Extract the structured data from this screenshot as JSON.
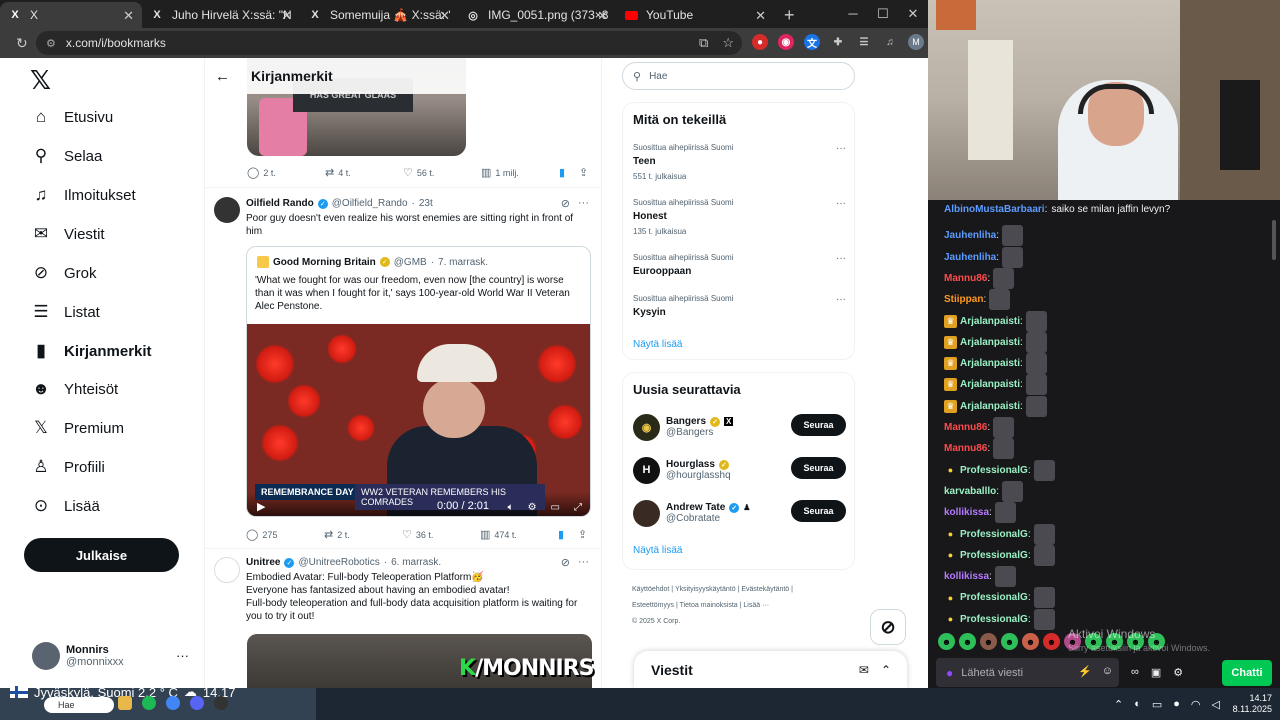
{
  "browser": {
    "tabs": [
      {
        "label": "X",
        "icon": "x-logo-icon",
        "active": true
      },
      {
        "label": "Juho Hirvelä X:ssä: \"Neljäs tans",
        "icon": "x-logo-icon"
      },
      {
        "label": "Somemuija 🎪 X:ssä: \"Hei isä! I",
        "icon": "x-logo-icon"
      },
      {
        "label": "IMG_0051.png (373×807)",
        "icon": "globe-icon"
      },
      {
        "label": "YouTube",
        "icon": "youtube-icon"
      }
    ],
    "url": "x.com/i/bookmarks"
  },
  "nav": {
    "items": [
      {
        "label": "Etusivu",
        "icon": "home-icon"
      },
      {
        "label": "Selaa",
        "icon": "search-icon"
      },
      {
        "label": "Ilmoitukset",
        "icon": "bell-icon"
      },
      {
        "label": "Viestit",
        "icon": "envelope-icon"
      },
      {
        "label": "Grok",
        "icon": "grok-icon"
      },
      {
        "label": "Listat",
        "icon": "list-icon"
      },
      {
        "label": "Kirjanmerkit",
        "icon": "bookmark-icon"
      },
      {
        "label": "Yhteisöt",
        "icon": "people-icon"
      },
      {
        "label": "Premium",
        "icon": "x-logo-icon"
      },
      {
        "label": "Profiili",
        "icon": "person-icon"
      },
      {
        "label": "Lisää",
        "icon": "more-circle-icon"
      }
    ],
    "post_button": "Julkaise",
    "account": {
      "name": "Monnirs",
      "handle": "@monnixxx"
    }
  },
  "timeline": {
    "title": "Kirjanmerkit",
    "top_image_text": "HAS GREAT GLAAS",
    "top_actions": {
      "replies": "2 t.",
      "reposts": "4 t.",
      "likes": "56 t.",
      "views": "1 milj."
    },
    "tweet1": {
      "name": "Oilfield Rando",
      "handle": "@Oilfield_Rando",
      "time": "23t",
      "text": "Poor guy doesn't even realize his worst enemies are sitting right in front of him",
      "quote": {
        "name": "Good Morning Britain",
        "handle": "@GMB",
        "time": "7. marrask.",
        "text": "'What we fought for was our freedom, even now [the country] is worse than it was when I fought for it,' says 100-year-old World War II Veteran Alec Penstone.",
        "banner_left": "REMEMBRANCE DAY",
        "banner_right": "WW2 VETERAN REMEMBERS HIS COMRADES",
        "video_time": "0:00 / 2:01"
      },
      "actions": {
        "replies": "275",
        "reposts": "2 t.",
        "likes": "36 t.",
        "views": "474 t."
      }
    },
    "tweet2": {
      "name": "Unitree",
      "handle": "@UnitreeRobotics",
      "time": "6. marrask.",
      "line1": "Embodied Avatar: Full-body Teleoperation Platform🥳",
      "line2": "Everyone has fantasized about having an embodied avatar!",
      "line3": "Full-body teleoperation and full-body data acquisition platform is waiting for you to try it out!"
    }
  },
  "sidebar": {
    "search_placeholder": "Hae",
    "trending_title": "Mitä on tekeillä",
    "trends": [
      {
        "context": "Suosittua aihepiirissä Suomi",
        "name": "Teen",
        "count": "551 t. julkaisua"
      },
      {
        "context": "Suosittua aihepiirissä Suomi",
        "name": "Honest",
        "count": "135 t. julkaisua"
      },
      {
        "context": "Suosittua aihepiirissä Suomi",
        "name": "Eurooppaan",
        "count": ""
      },
      {
        "context": "Suosittua aihepiirissä Suomi",
        "name": "Kysyin",
        "count": ""
      }
    ],
    "show_more": "Näytä lisää",
    "follow_title": "Uusia seurattavia",
    "follows": [
      {
        "name": "Bangers",
        "handle": "@Bangers",
        "button": "Seuraa"
      },
      {
        "name": "Hourglass",
        "handle": "@hourglasshq",
        "button": "Seuraa"
      },
      {
        "name": "Andrew Tate",
        "handle": "@Cobratate",
        "button": "Seuraa"
      }
    ],
    "footer_line1": "Käyttöehdot  |  Yksityisyyskäytäntö  |  Evästekäytäntö  |",
    "footer_line2": "Esteettömyys  |  Tietoa mainoksista  |  Lisää ···",
    "footer_line3": "© 2025 X Corp.",
    "messages_title": "Viestit"
  },
  "chat": {
    "messages": [
      {
        "user": "AlbinoMustaBarbaari",
        "text": "saiko se milan jaffin levyn?",
        "color": "#5c9cff",
        "badge": "",
        "emote": false
      },
      {
        "user": "Jauhenliha",
        "text": "",
        "color": "#5c9cff",
        "badge": "",
        "emote": true
      },
      {
        "user": "Jauhenliha",
        "text": "",
        "color": "#5c9cff",
        "badge": "",
        "emote": true
      },
      {
        "user": "Mannu86",
        "text": "",
        "color": "#ff4b4b",
        "badge": "",
        "emote": true
      },
      {
        "user": "Stiippan",
        "text": "",
        "color": "#ff9a1f",
        "badge": "",
        "emote": true
      },
      {
        "user": "Arjalanpaisti",
        "text": "",
        "color": "#9af0c4",
        "badge": "crown",
        "emote": true
      },
      {
        "user": "Arjalanpaisti",
        "text": "",
        "color": "#9af0c4",
        "badge": "crown",
        "emote": true
      },
      {
        "user": "Arjalanpaisti",
        "text": "",
        "color": "#9af0c4",
        "badge": "crown",
        "emote": true
      },
      {
        "user": "Arjalanpaisti",
        "text": "",
        "color": "#9af0c4",
        "badge": "crown",
        "emote": true
      },
      {
        "user": "Arjalanpaisti",
        "text": "",
        "color": "#9af0c4",
        "badge": "crown",
        "emote": true
      },
      {
        "user": "Mannu86",
        "text": "",
        "color": "#ff4b4b",
        "badge": "",
        "emote": true
      },
      {
        "user": "Mannu86",
        "text": "",
        "color": "#ff4b4b",
        "badge": "",
        "emote": true
      },
      {
        "user": "ProfessionalG",
        "text": "",
        "color": "#9af0c4",
        "badge": "lemon",
        "emote": true
      },
      {
        "user": "karvaballlo",
        "text": "",
        "color": "#9af0c4",
        "badge": "",
        "emote": true
      },
      {
        "user": "kollikissa",
        "text": "",
        "color": "#b57bff",
        "badge": "",
        "emote": true
      },
      {
        "user": "ProfessionalG",
        "text": "",
        "color": "#9af0c4",
        "badge": "lemon",
        "emote": true
      },
      {
        "user": "ProfessionalG",
        "text": "",
        "color": "#9af0c4",
        "badge": "lemon",
        "emote": true
      },
      {
        "user": "kollikissa",
        "text": "",
        "color": "#b57bff",
        "badge": "",
        "emote": true
      },
      {
        "user": "ProfessionalG",
        "text": "",
        "color": "#9af0c4",
        "badge": "lemon",
        "emote": true
      },
      {
        "user": "ProfessionalG",
        "text": "",
        "color": "#9af0c4",
        "badge": "lemon",
        "emote": true
      }
    ],
    "activate_title": "Aktivoi Windows",
    "activate_sub": "Siirry asetuksiin ja aktivoi Windows.",
    "input_placeholder": "Lähetä viesti",
    "chat_button": "Chatti"
  },
  "taskbar": {
    "weather": "Jyväskylä, Suomi   2,2 ° C",
    "overlay_time": "14.17",
    "search": "Hae",
    "overlay_k": "K",
    "overlay_text": "/MONNIRS",
    "clock_time": "14.17",
    "clock_date": "8.11.2025"
  }
}
